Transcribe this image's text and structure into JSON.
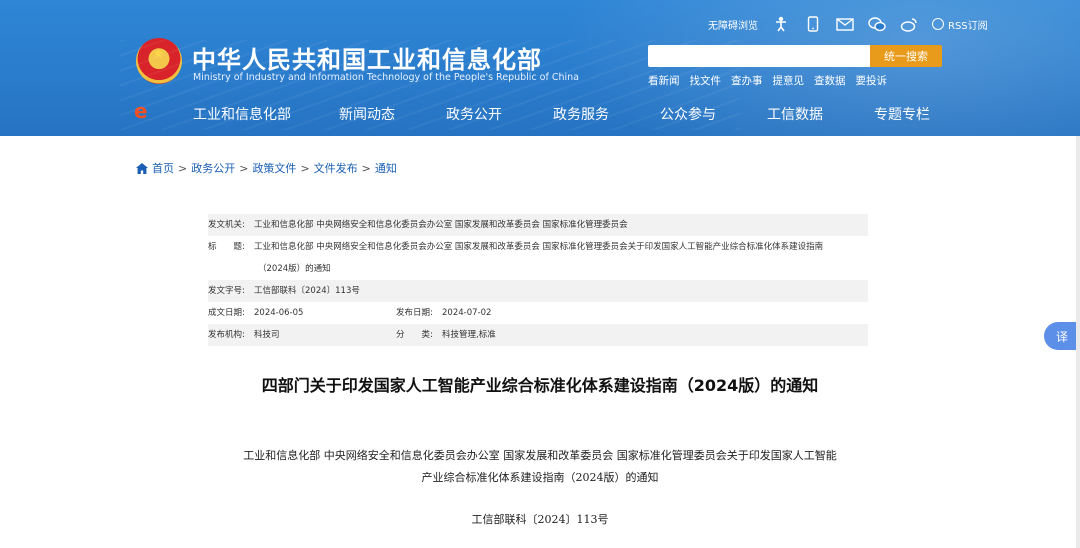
{
  "header": {
    "title_cn": "中华人民共和国工业和信息化部",
    "title_en": "Ministry of Industry and Information Technology of the People's Republic of China",
    "accessible_label": "无障碍浏览",
    "rss_label": "RSS订阅",
    "search": {
      "placeholder": "",
      "button": "统一搜索"
    },
    "quick_links": [
      "看新闻",
      "找文件",
      "查办事",
      "提意见",
      "查数据",
      "要投诉"
    ],
    "nav": [
      "工业和信息化部",
      "新闻动态",
      "政务公开",
      "政务服务",
      "公众参与",
      "工信数据",
      "专题专栏"
    ]
  },
  "breadcrumb": [
    "首页",
    "政务公开",
    "政策文件",
    "文件发布",
    "通知"
  ],
  "breadcrumb_sep": ">",
  "info": {
    "issuer_label": "发文机关:",
    "issuer": "工业和信息化部 中央网络安全和信息化委员会办公室 国家发展和改革委员会 国家标准化管理委员会",
    "title_label": "标　　题:",
    "title_line1": "工业和信息化部 中央网络安全和信息化委员会办公室 国家发展和改革委员会 国家标准化管理委员会关于印发国家人工智能产业综合标准化体系建设指南",
    "title_line2": "（2024版）的通知",
    "docno_label": "发文字号:",
    "docno": "工信部联科〔2024〕113号",
    "written_label": "成文日期:",
    "written": "2024-06-05",
    "published_label": "发布日期:",
    "published": "2024-07-02",
    "org_label": "发布机构:",
    "org": "科技司",
    "category_label": "分　　类:",
    "category": "科技管理,标准"
  },
  "doc_title": "四部门关于印发国家人工智能产业综合标准化体系建设指南（2024版）的通知",
  "body": {
    "line1": "工业和信息化部 中央网络安全和信息化委员会办公室 国家发展和改革委员会 国家标准化管理委员会关于印发国家人工智能",
    "line2": "产业综合标准化体系建设指南（2024版）的通知",
    "line3": "工信部联科〔2024〕113号"
  },
  "translate_label": "译"
}
